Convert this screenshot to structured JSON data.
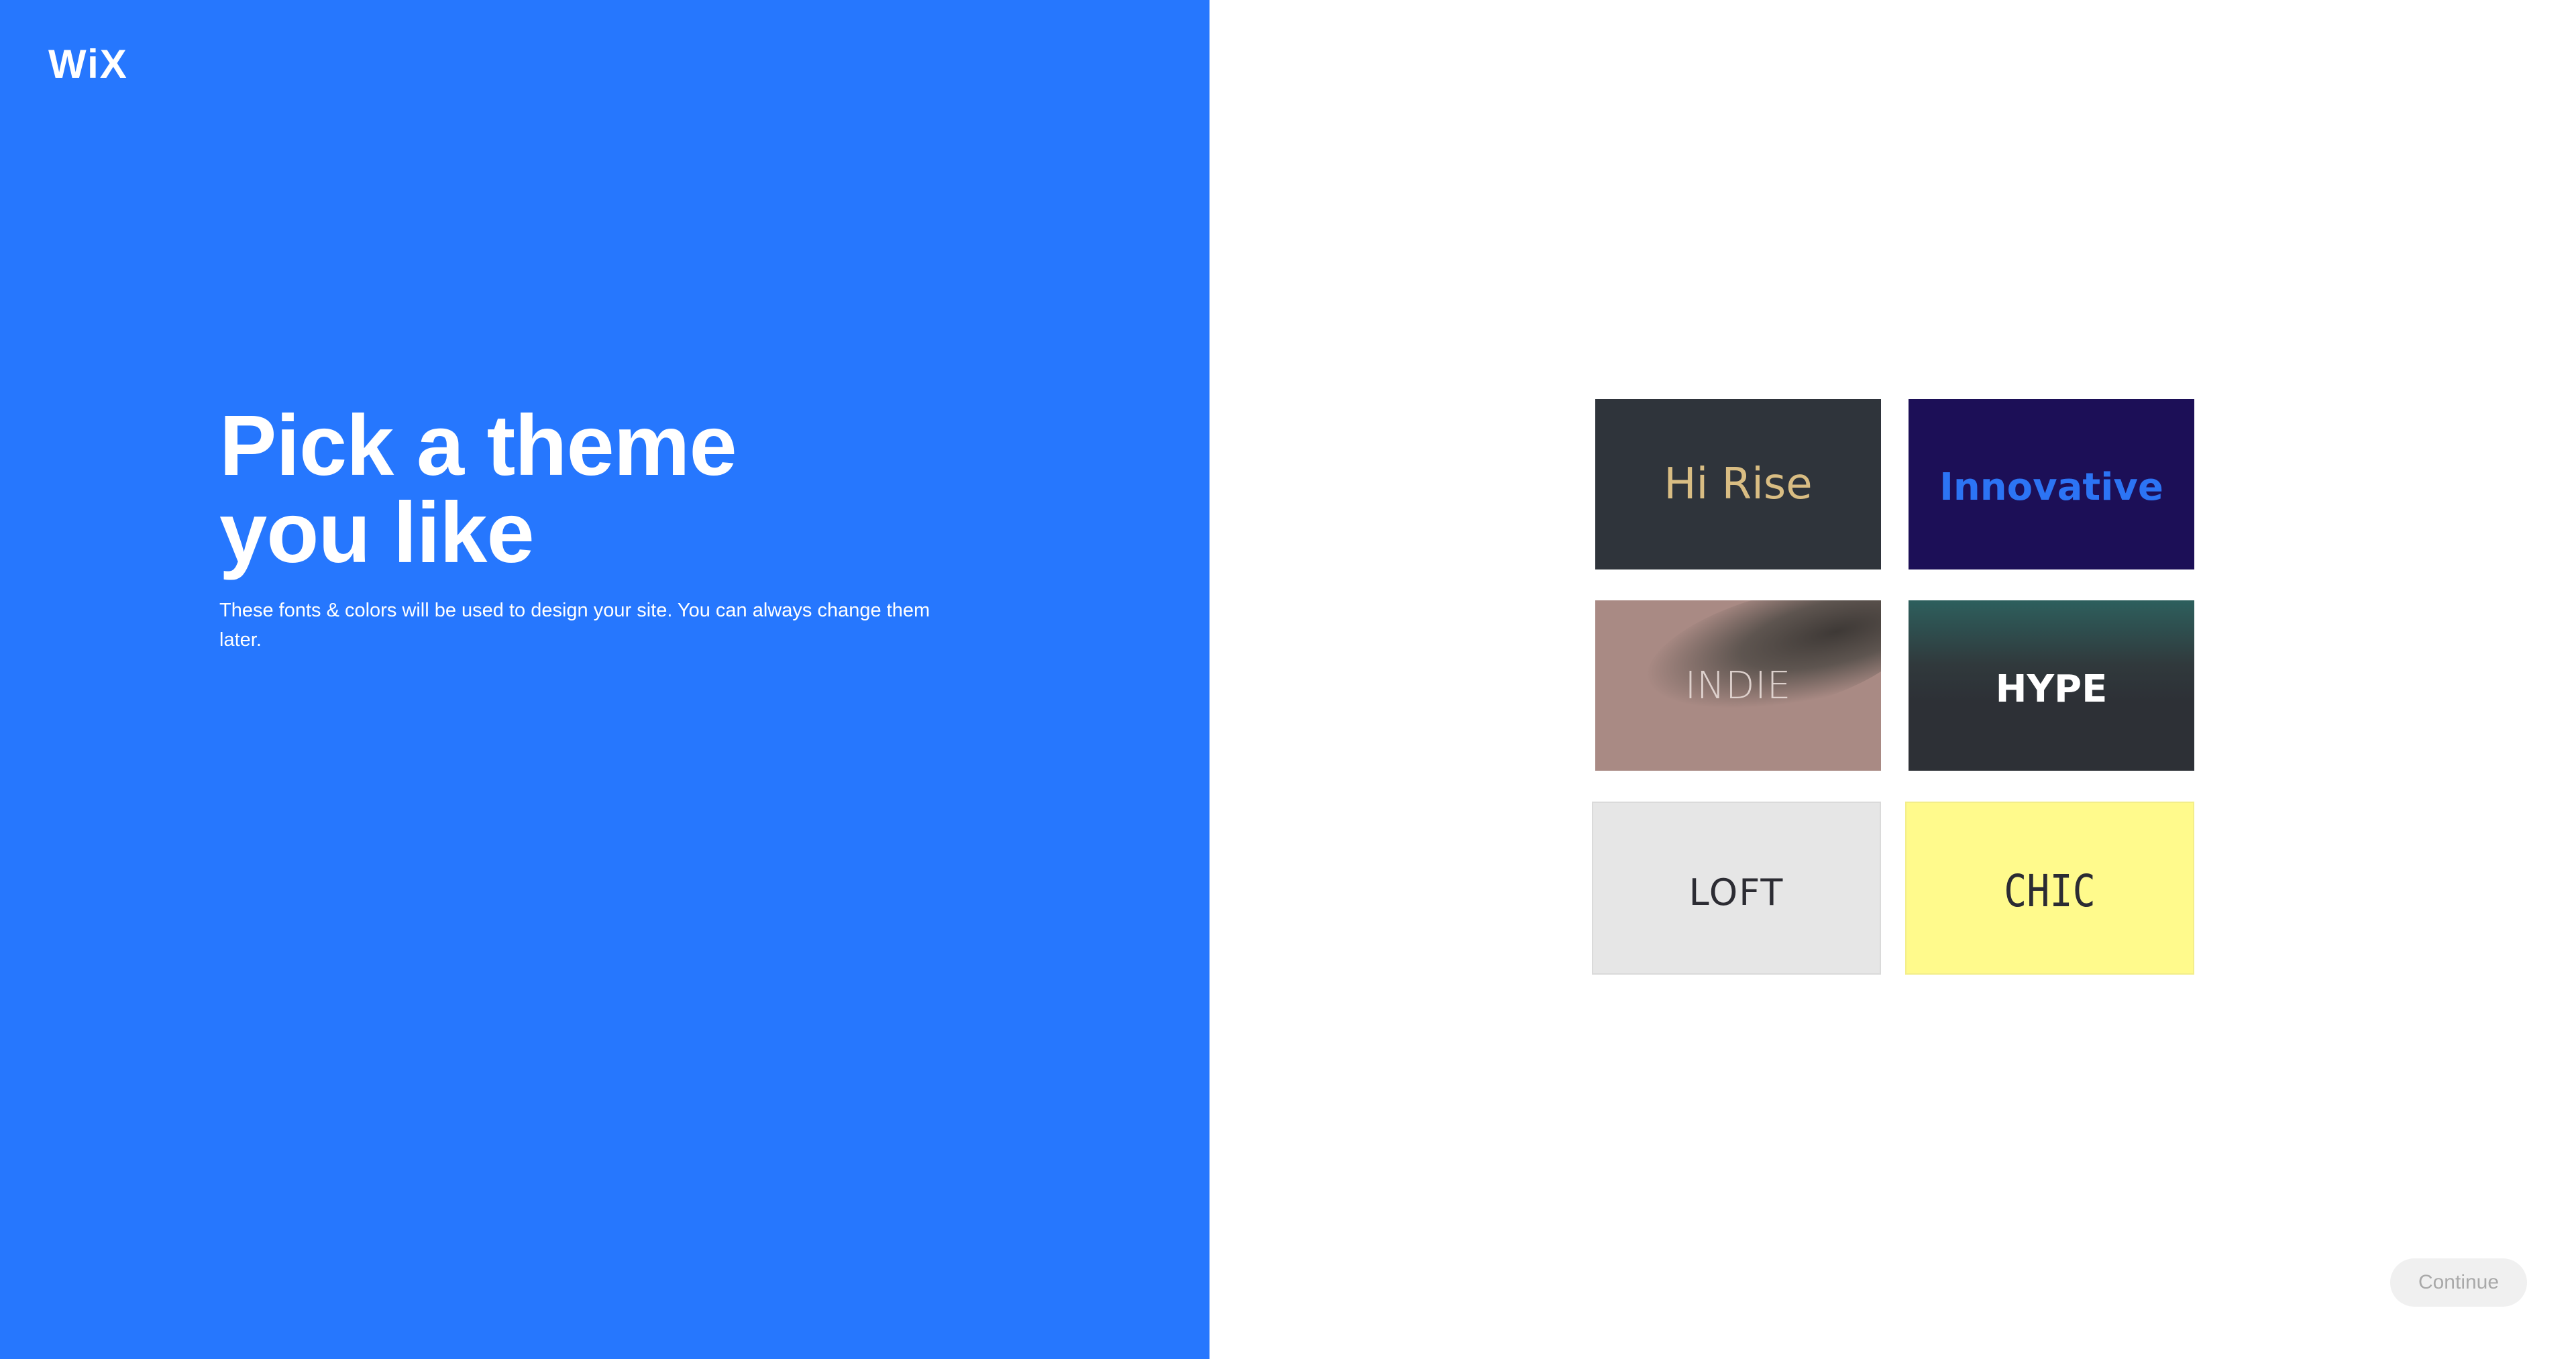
{
  "brand": {
    "logo_text": "WiX",
    "accent_color": "#2677fe"
  },
  "intro": {
    "heading_line1": "Pick a theme",
    "heading_line2": "you like",
    "subtitle": "These fonts & colors will be used to design your site. You can always change them later."
  },
  "themes": [
    {
      "name": "Hi Rise",
      "background": "#2f343b",
      "text_color": "#d9bd83"
    },
    {
      "name": "Innovative",
      "background": "#1c0f57",
      "text_color": "#2c74f4"
    },
    {
      "name": "INDIE",
      "background": "#a98a84",
      "text_color": "#e8dcd8"
    },
    {
      "name": "HYPE",
      "background": "#2d3036",
      "text_color": "#ffffff"
    },
    {
      "name": "LOFT",
      "background": "#e6e6e6",
      "text_color": "#2c2c33"
    },
    {
      "name": "CHIC",
      "background": "#fffa8c",
      "text_color": "#2b2b33"
    }
  ],
  "footer": {
    "continue_label": "Continue"
  }
}
